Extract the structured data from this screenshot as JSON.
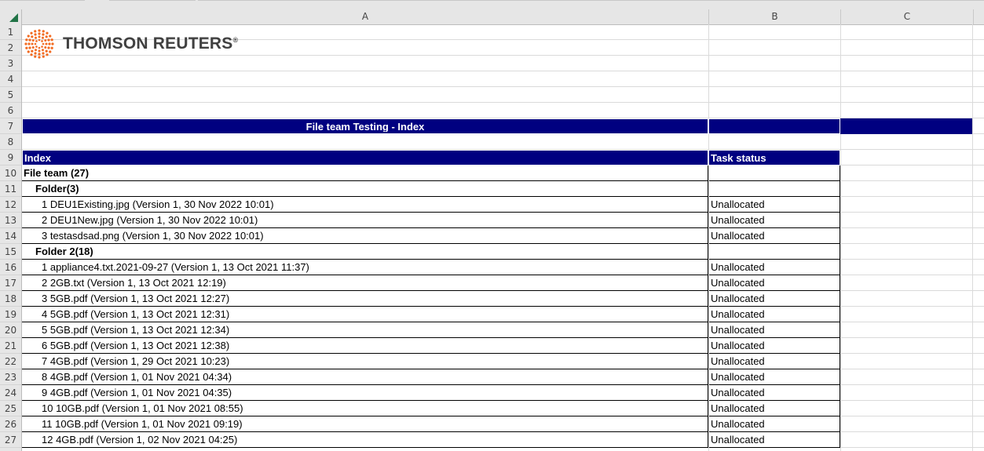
{
  "columns": [
    "A",
    "B",
    "C"
  ],
  "row_numbers": [
    1,
    2,
    3,
    4,
    5,
    6,
    7,
    8,
    9,
    10,
    11,
    12,
    13,
    14,
    15,
    16,
    17,
    18,
    19,
    20,
    21,
    22,
    23,
    24,
    25,
    26,
    27
  ],
  "logo": {
    "text": "THOMSON REUTERS",
    "mark": "®",
    "color": "#f26b21"
  },
  "title": "File team Testing - Index",
  "header": {
    "index": "Index",
    "status": "Task status"
  },
  "colors": {
    "navy": "#000080"
  },
  "rows": [
    {
      "text": "File team (27)",
      "indent": 0,
      "bold": true,
      "status": ""
    },
    {
      "text": "Folder(3)",
      "indent": 1,
      "bold": true,
      "status": ""
    },
    {
      "text": "1 DEU1Existing.jpg  (Version 1, 30 Nov 2022 10:01)",
      "indent": 2,
      "bold": false,
      "status": "Unallocated"
    },
    {
      "text": "2 DEU1New.jpg  (Version 1, 30 Nov 2022 10:01)",
      "indent": 2,
      "bold": false,
      "status": "Unallocated"
    },
    {
      "text": "3 testasdsad.png  (Version 1, 30 Nov 2022 10:01)",
      "indent": 2,
      "bold": false,
      "status": "Unallocated"
    },
    {
      "text": "Folder 2(18)",
      "indent": 1,
      "bold": true,
      "status": ""
    },
    {
      "text": "1 appliance4.txt.2021-09-27  (Version 1, 13 Oct 2021 11:37)",
      "indent": 2,
      "bold": false,
      "status": "Unallocated"
    },
    {
      "text": "2 2GB.txt  (Version 1, 13 Oct 2021 12:19)",
      "indent": 2,
      "bold": false,
      "status": "Unallocated"
    },
    {
      "text": "3 5GB.pdf  (Version 1, 13 Oct 2021 12:27)",
      "indent": 2,
      "bold": false,
      "status": "Unallocated"
    },
    {
      "text": "4 5GB.pdf  (Version 1, 13 Oct 2021 12:31)",
      "indent": 2,
      "bold": false,
      "status": "Unallocated"
    },
    {
      "text": "5 5GB.pdf  (Version 1, 13 Oct 2021 12:34)",
      "indent": 2,
      "bold": false,
      "status": "Unallocated"
    },
    {
      "text": "6 5GB.pdf  (Version 1, 13 Oct 2021 12:38)",
      "indent": 2,
      "bold": false,
      "status": "Unallocated"
    },
    {
      "text": "7 4GB.pdf  (Version 1, 29 Oct 2021 10:23)",
      "indent": 2,
      "bold": false,
      "status": "Unallocated"
    },
    {
      "text": "8 4GB.pdf  (Version 1, 01 Nov 2021 04:34)",
      "indent": 2,
      "bold": false,
      "status": "Unallocated"
    },
    {
      "text": "9 4GB.pdf  (Version 1, 01 Nov 2021 04:35)",
      "indent": 2,
      "bold": false,
      "status": "Unallocated"
    },
    {
      "text": "10 10GB.pdf  (Version 1, 01 Nov 2021 08:55)",
      "indent": 2,
      "bold": false,
      "status": "Unallocated"
    },
    {
      "text": "11 10GB.pdf  (Version 1, 01 Nov 2021 09:19)",
      "indent": 2,
      "bold": false,
      "status": "Unallocated"
    },
    {
      "text": "12 4GB.pdf  (Version 1, 02 Nov 2021 04:25)",
      "indent": 2,
      "bold": false,
      "status": "Unallocated"
    }
  ]
}
